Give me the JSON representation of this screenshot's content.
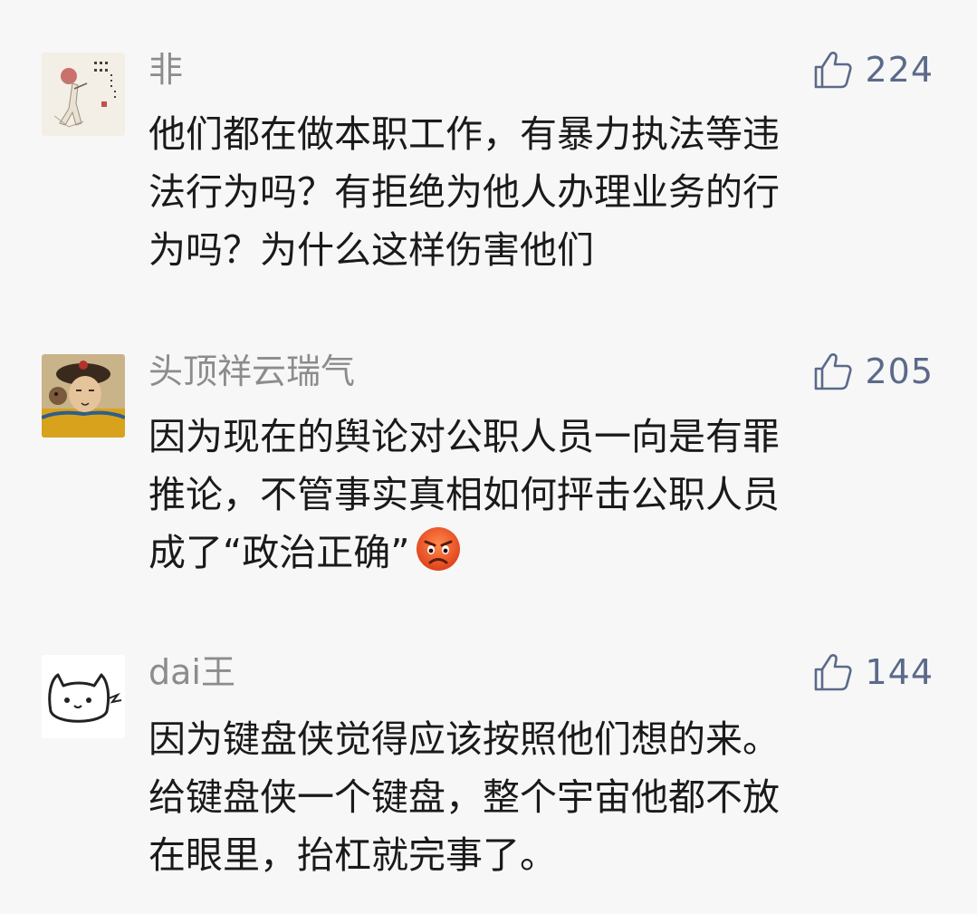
{
  "comments": [
    {
      "nickname": "非",
      "likes": "224",
      "avatar": "calligraphy-figure-painting",
      "lines": [
        "他们都在做本职工作，有暴力执法等违",
        "法行为吗？有拒绝为他人办理业务的行",
        "为吗？为什么这样伤害他们"
      ]
    },
    {
      "nickname": "头顶祥云瑞气",
      "likes": "205",
      "avatar": "qing-emperor-portrait",
      "lines": [
        "因为现在的舆论对公职人员一向是有罪",
        "推论，不管事实真相如何抨击公职人员",
        "成了“政治正确”"
      ],
      "trailing_emoji": "angry-face"
    },
    {
      "nickname": "dai王",
      "likes": "144",
      "avatar": "white-cartoon-cat",
      "lines": [
        "因为键盘侠觉得应该按照他们想的来。",
        "给键盘侠一个键盘，整个宇宙他都不放",
        "在眼里，抬杠就完事了。"
      ]
    }
  ],
  "icons": {
    "like": "thumbs-up-icon",
    "emoji": "angry-face-icon"
  },
  "colors": {
    "background": "#f7f7f7",
    "nickname": "#8c8c8c",
    "like": "#5b6a8a",
    "body_text": "#1a1a1a"
  }
}
